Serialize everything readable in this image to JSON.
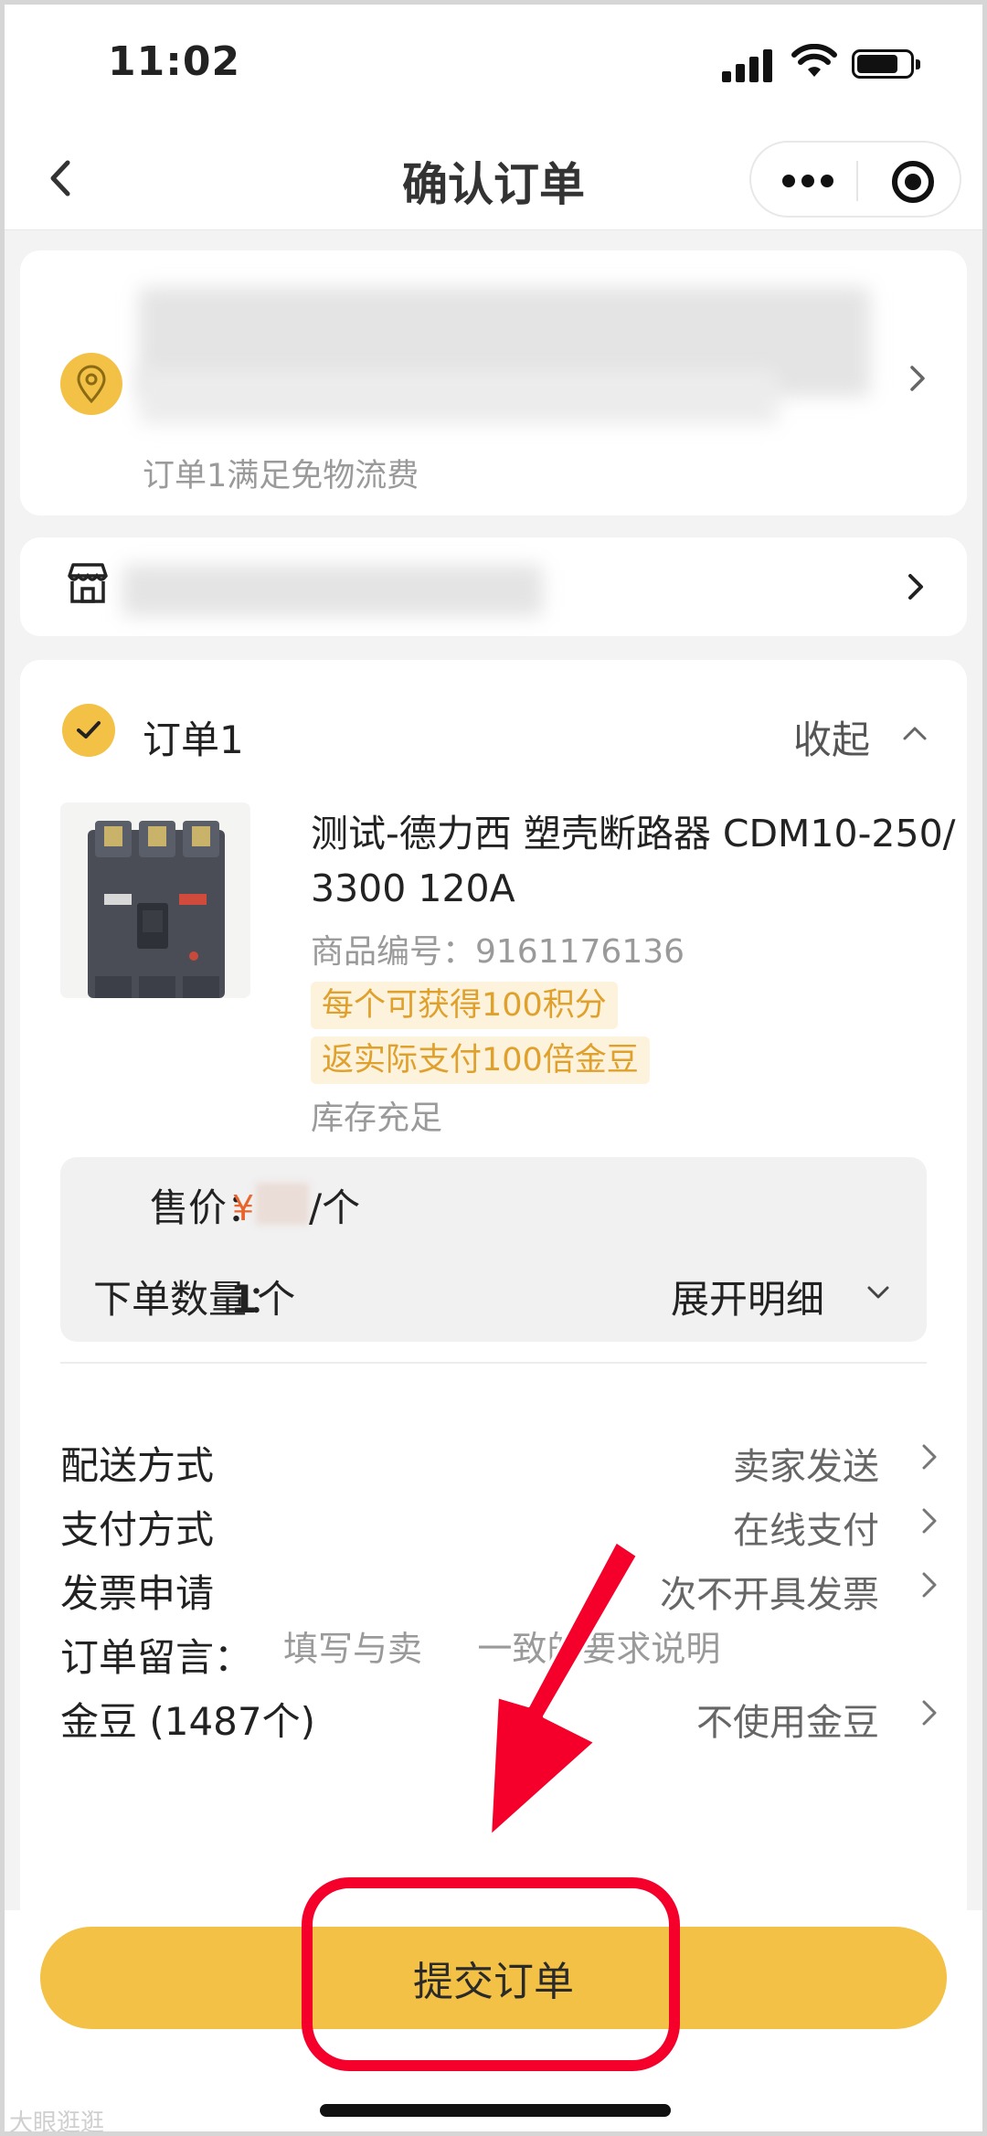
{
  "status_bar": {
    "time": "11:02"
  },
  "nav": {
    "title": "确认订单"
  },
  "address": {
    "note": "订单1满足免物流费"
  },
  "order": {
    "title": "订单1",
    "collapse_label": "收起",
    "product": {
      "name": "测试-德力西 塑壳断路器 CDM10-250/3300 120A",
      "sku": "商品编号：9161176136",
      "tags": [
        "每个可获得100积分",
        "返实际支付100倍金豆"
      ],
      "stock": "库存充足"
    },
    "price": {
      "label": "售价：",
      "currency": "¥",
      "unit": "/个"
    },
    "quantity": {
      "label": "下单数量：",
      "value": "1",
      "unit": "个",
      "expand_label": "展开明细"
    },
    "rows": [
      {
        "label": "配送方式",
        "value": "卖家发送"
      },
      {
        "label": "支付方式",
        "value": "在线支付"
      },
      {
        "label": "发票申请",
        "value": "次不开具发票"
      },
      {
        "label": "订单留言：",
        "placeholder": "填写与卖     一致的要求说明"
      },
      {
        "label": "金豆 (1487个)",
        "value": "不使用金豆"
      }
    ]
  },
  "submit_label": "提交订单",
  "watermark": "大眼逛逛",
  "colors": {
    "accent": "#f2c145",
    "price": "#e8642c",
    "annotation": "#f4002a",
    "tag_text": "#e0a12c"
  }
}
